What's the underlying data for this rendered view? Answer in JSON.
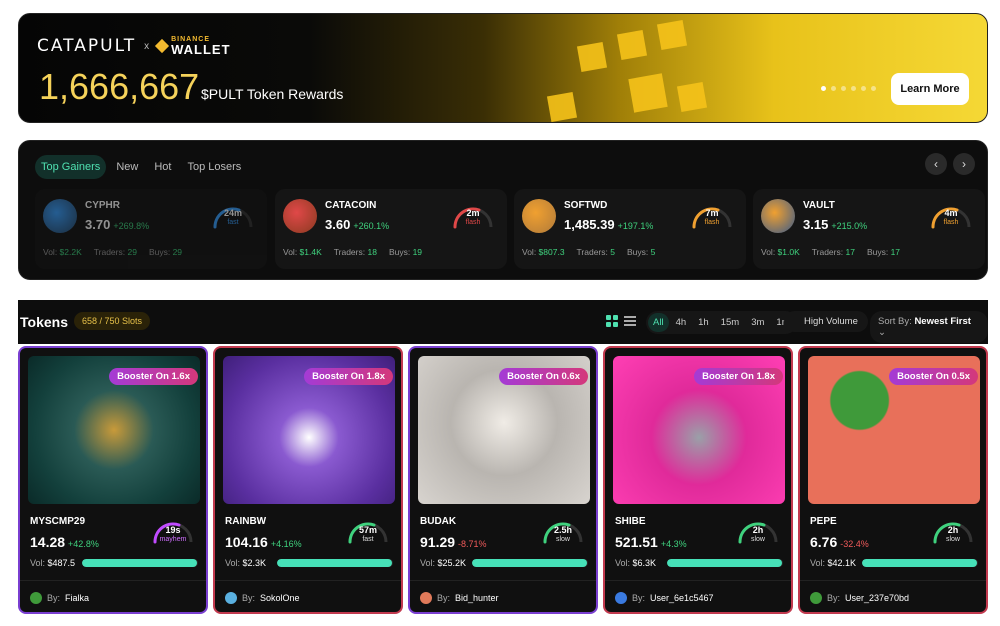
{
  "banner": {
    "logo_main": "CATAPULT",
    "logo_small": "TRADE",
    "logo_x": "x",
    "binance_top": "BINANCE",
    "binance_bottom": "WALLET",
    "amount": "1,666,667",
    "subtitle": "$PULT Token Rewards",
    "cta": "Learn More",
    "slide_count": 6,
    "active_slide": 1
  },
  "movers": {
    "tabs": [
      "Top Gainers",
      "New",
      "Hot",
      "Top Losers"
    ],
    "active_tab": "Top Gainers",
    "prev": "‹",
    "next": "›",
    "vol_label": "Vol:",
    "traders_label": "Traders:",
    "buys_label": "Buys:",
    "cards": [
      {
        "name": "CYPHR",
        "price": "3.70",
        "change": "+269.8%",
        "time": "24m",
        "speed": "fast",
        "vol": "$2.2K",
        "traders": "29",
        "buys": "29",
        "color": "#3aa0ff",
        "avatar": "#2a4a6a"
      },
      {
        "name": "CATACOIN",
        "price": "3.60",
        "change": "+260.1%",
        "time": "2m",
        "speed": "flash",
        "vol": "$1.4K",
        "traders": "18",
        "buys": "19",
        "color": "#e04848",
        "avatar": "#8a3a20"
      },
      {
        "name": "SOFTWD",
        "price": "1,485.39",
        "change": "+197.1%",
        "time": "7m",
        "speed": "flash",
        "vol": "$807.3",
        "traders": "5",
        "buys": "5",
        "color": "#f0a030",
        "avatar": "#b07a3a"
      },
      {
        "name": "VAULT",
        "price": "3.15",
        "change": "+215.0%",
        "time": "4m",
        "speed": "flash",
        "vol": "$1.0K",
        "traders": "17",
        "buys": "17",
        "color": "#f0a030",
        "avatar": "#3a5a8a"
      }
    ]
  },
  "tokens": {
    "title": "Tokens",
    "slots": "658 / 750 Slots",
    "timeframes": [
      "All",
      "4h",
      "1h",
      "15m",
      "3m",
      "1m"
    ],
    "active_timeframe": "All",
    "high_volume": "High Volume",
    "sort_label": "Sort By:",
    "sort_value": "Newest First",
    "vol_label": "Vol:",
    "by_label": "By:",
    "cards": [
      {
        "symbol": "MYSCMP29",
        "price": "14.28",
        "change": "+42.8%",
        "dir": "pos",
        "boost": "Booster On 1.6x",
        "time": "19s",
        "speed": "mayhem",
        "vol": "$487.5",
        "vol_level": 0.99,
        "creator": "Fialka",
        "border": "purple"
      },
      {
        "symbol": "RAINBW",
        "price": "104.16",
        "change": "+4.16%",
        "dir": "pos",
        "boost": "Booster On 1.8x",
        "time": "57m",
        "speed": "fast",
        "vol": "$2.3K",
        "vol_level": 0.99,
        "creator": "SokolOne",
        "border": "red"
      },
      {
        "symbol": "BUDAK",
        "price": "91.29",
        "change": "-8.71%",
        "dir": "neg",
        "boost": "Booster On 0.6x",
        "time": "2.5h",
        "speed": "slow",
        "vol": "$25.2K",
        "vol_level": 0.99,
        "creator": "Bid_hunter",
        "border": "purple"
      },
      {
        "symbol": "SHIBE",
        "price": "521.51",
        "change": "+4.3%",
        "dir": "pos",
        "boost": "Booster On 1.8x",
        "time": "2h",
        "speed": "slow",
        "vol": "$6.3K",
        "vol_level": 0.99,
        "creator": "User_6e1c5467",
        "border": "red"
      },
      {
        "symbol": "PEPE",
        "price": "6.76",
        "change": "-32.4%",
        "dir": "neg",
        "boost": "Booster On 0.5x",
        "time": "2h",
        "speed": "slow",
        "vol": "$42.1K",
        "vol_level": 0.99,
        "creator": "User_237e70bd",
        "border": "red"
      }
    ]
  }
}
